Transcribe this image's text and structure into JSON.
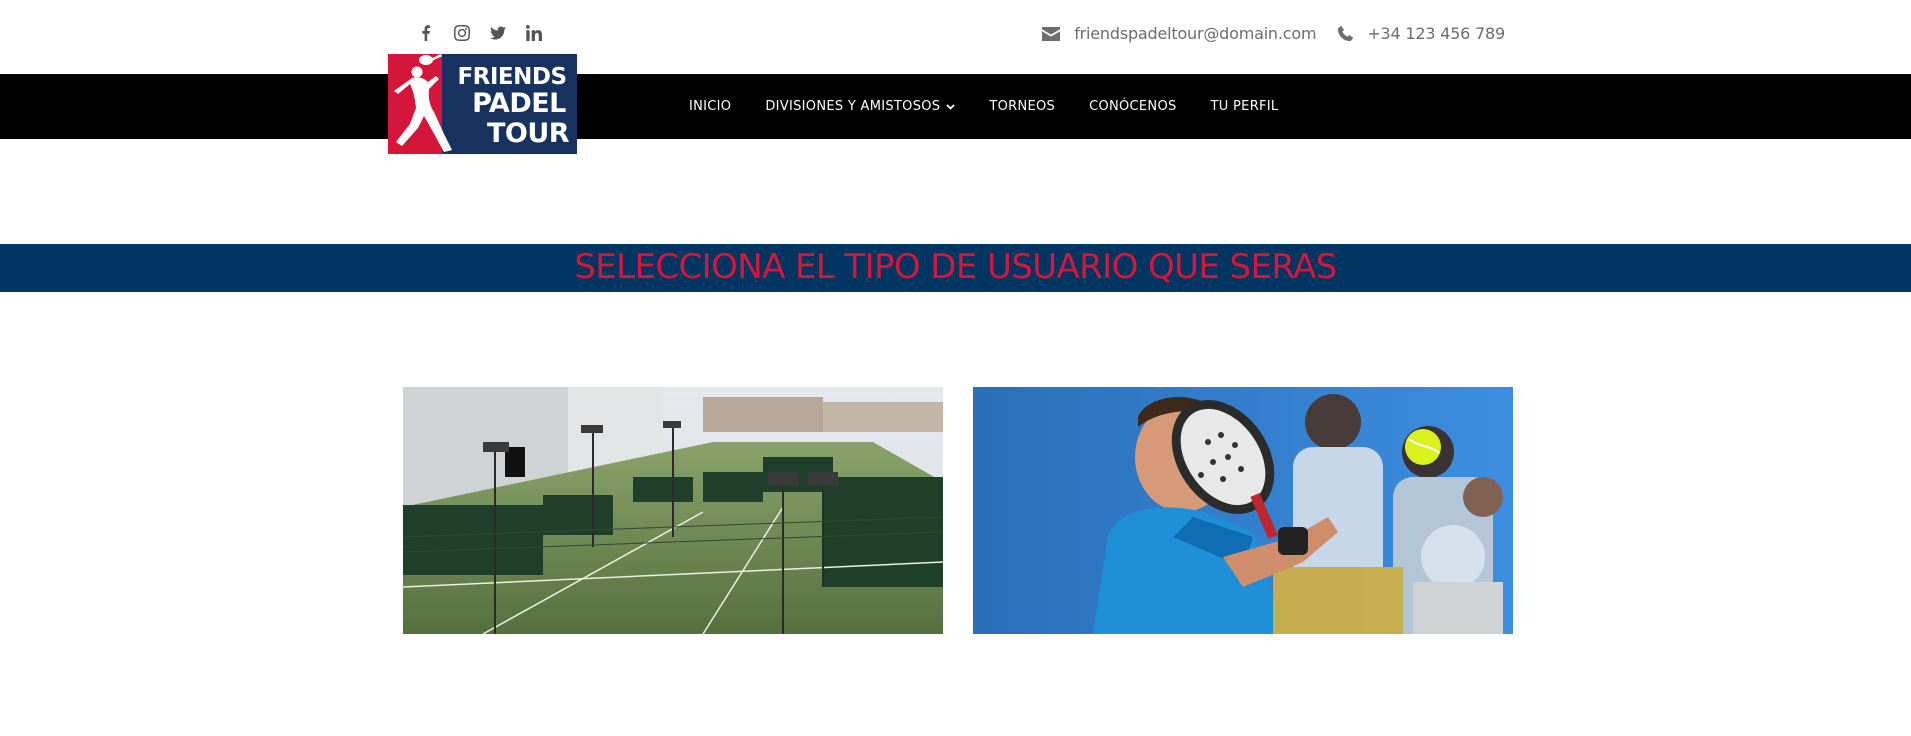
{
  "header": {
    "social": [
      {
        "icon": "facebook-icon"
      },
      {
        "icon": "instagram-icon"
      },
      {
        "icon": "twitter-icon"
      },
      {
        "icon": "linkedin-icon"
      }
    ],
    "contact": {
      "email": "friendspadeltour@domain.com",
      "phone": "+34 123 456 789",
      "email_icon": "envelope-icon",
      "phone_icon": "phone-icon"
    }
  },
  "logo": {
    "lines": [
      "FRIENDS",
      "PADEL",
      "TOUR"
    ],
    "colors": {
      "red": "#d4163a",
      "navy": "#003461"
    }
  },
  "nav": {
    "items": [
      {
        "label": "INICIO"
      },
      {
        "label": "DIVISIONES Y AMISTOSOS",
        "has_dropdown": true
      },
      {
        "label": "TORNEOS"
      },
      {
        "label": "CONÓCENOS"
      },
      {
        "label": "TU PERFIL"
      }
    ]
  },
  "banner": {
    "title": "SELECCIONA EL TIPO DE USUARIO QUE SERAS",
    "background": "#003461",
    "text_color": "#d4163a"
  },
  "cards": [
    {
      "image": "padel-courts-photo"
    },
    {
      "image": "padel-player-photo"
    }
  ]
}
